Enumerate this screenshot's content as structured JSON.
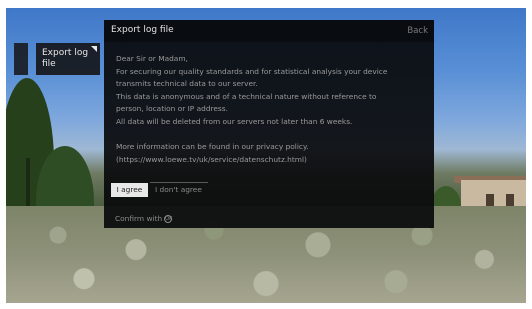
{
  "menu": {
    "item_label": "Export log file"
  },
  "dialog": {
    "title": "Export log file",
    "back_label": "Back",
    "body_lines": [
      "Dear Sir or Madam,",
      "For securing our quality standards and for statistical analysis your device",
      "transmits technical data to our server.",
      "This data is anonymous and of a technical nature without reference to",
      "person, location or IP address.",
      "All data will be deleted from our servers not later than 6 weeks."
    ],
    "privacy_lines": [
      "More information can be found in our privacy policy.",
      "(https://www.loewe.tv/uk/service/datenschutz.html)"
    ],
    "agree_label": "I agree",
    "disagree_label": "I don't agree",
    "confirm_label": "Confirm with",
    "confirm_icon": "ok-button-icon"
  }
}
